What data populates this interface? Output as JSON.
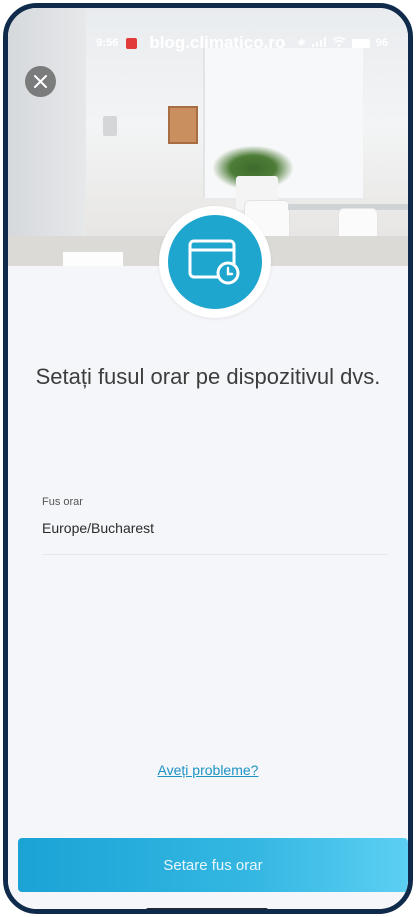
{
  "status_bar": {
    "time": "9:56",
    "url": "blog.climatico.ro",
    "battery": "96"
  },
  "header": {
    "close_icon": "close-icon"
  },
  "main": {
    "badge_icon": "calendar-clock-icon",
    "title": "Setați fusul orar pe dispozitivul dvs.",
    "field": {
      "label": "Fus orar",
      "value": "Europe/Bucharest"
    },
    "help_link": "Aveți probleme?",
    "primary_button": "Setare fus orar"
  },
  "colors": {
    "accent": "#1ea6cf",
    "button_start": "#1ba3d6",
    "button_end": "#5ccff3",
    "frame": "#0f2a4a"
  }
}
